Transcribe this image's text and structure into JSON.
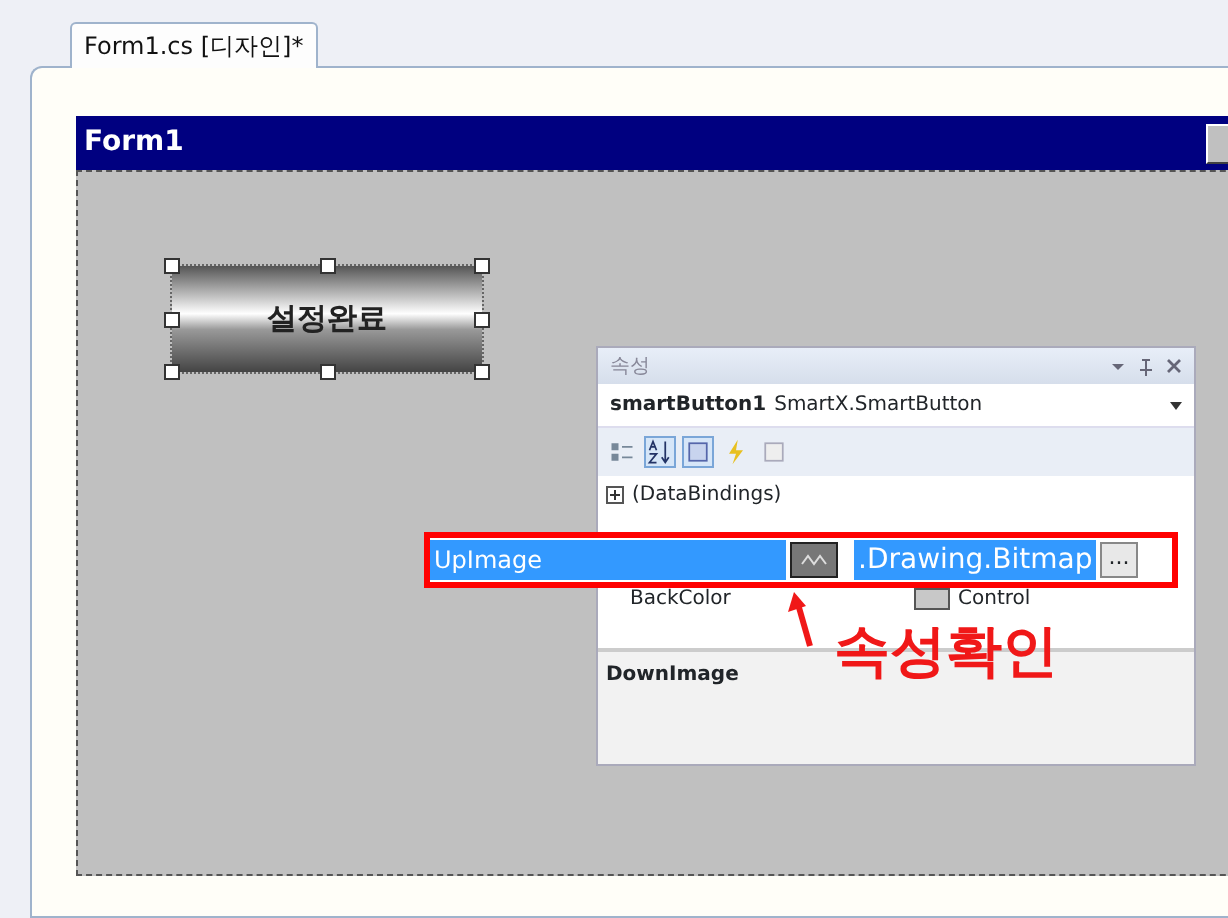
{
  "tab": {
    "label": "Form1.cs [디자인]*",
    "selected": true
  },
  "form": {
    "title": "Form1"
  },
  "smart_button": {
    "label": "설정완료",
    "selected": true
  },
  "properties": {
    "title": "속성",
    "object": "smartButton1",
    "object_type": "SmartX.SmartButton",
    "toolbar": [
      {
        "kind": "categorized",
        "selected": false
      },
      {
        "kind": "alphabetical",
        "selected": true
      },
      {
        "kind": "pages",
        "selected": true
      },
      {
        "kind": "events",
        "selected": false
      },
      {
        "kind": "property-pages",
        "selected": false
      }
    ],
    "rows": [
      {
        "kind": "group",
        "name": "(DataBindings)"
      },
      {
        "kind": "color",
        "name": "BackColor",
        "value": "Control",
        "color": "#c8c8c8"
      }
    ],
    "description": "DownImage"
  },
  "highlight": {
    "name": "UpImage",
    "value": ".Drawing.Bitmap",
    "ellipsis": "..."
  },
  "annotation": "속성확인"
}
